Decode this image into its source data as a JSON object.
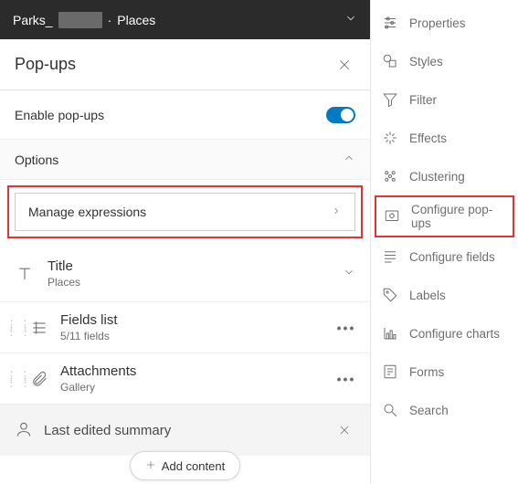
{
  "layerBar": {
    "name_a": "Parks_",
    "dot": "·",
    "name_b": "Places"
  },
  "panel": {
    "title": "Pop-ups",
    "enable_label": "Enable pop-ups",
    "options_label": "Options",
    "manage_label": "Manage expressions",
    "title_item": {
      "label": "Title",
      "sub": "Places"
    },
    "fields_item": {
      "label": "Fields list",
      "sub": "5/11 fields"
    },
    "attach_item": {
      "label": "Attachments",
      "sub": "Gallery"
    },
    "summary_label": "Last edited summary",
    "add_label": "Add content"
  },
  "tools": {
    "properties": "Properties",
    "styles": "Styles",
    "filter": "Filter",
    "effects": "Effects",
    "clustering": "Clustering",
    "configure_popups": "Configure pop-ups",
    "configure_fields": "Configure fields",
    "labels": "Labels",
    "configure_charts": "Configure charts",
    "forms": "Forms",
    "search": "Search"
  }
}
